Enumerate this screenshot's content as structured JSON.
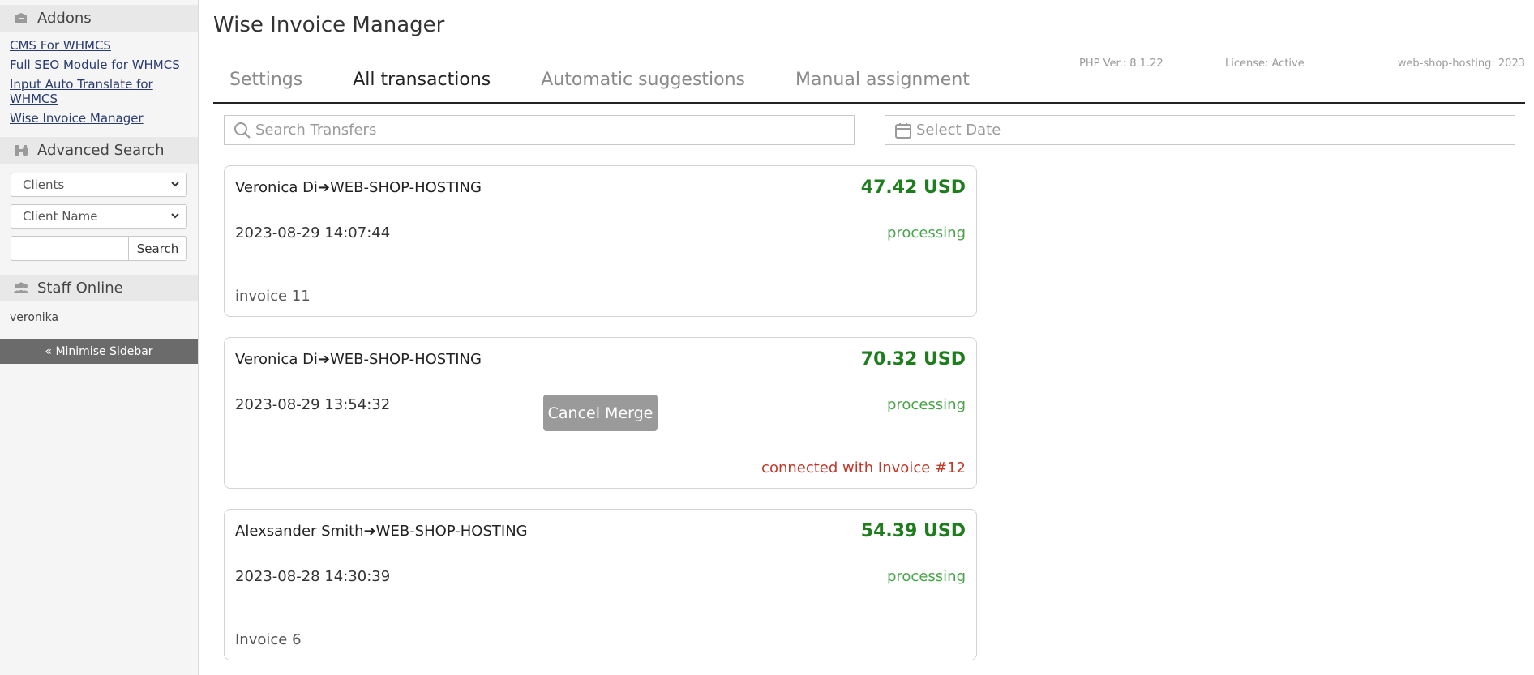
{
  "sidebar": {
    "addons_title": "Addons",
    "addon_links": [
      "CMS For WHMCS",
      "Full SEO Module for WHMCS",
      "Input Auto Translate for WHMCS",
      "Wise Invoice Manager"
    ],
    "advanced_search_title": "Advanced Search",
    "search_type": "Clients",
    "search_field": "Client Name",
    "search_button": "Search",
    "staff_online_title": "Staff Online",
    "staff_name": "veronika",
    "minimise_label": "« Minimise Sidebar"
  },
  "main": {
    "title": "Wise Invoice Manager",
    "tabs": [
      {
        "label": "Settings",
        "active": false
      },
      {
        "label": "All transactions",
        "active": true
      },
      {
        "label": "Automatic suggestions",
        "active": false
      },
      {
        "label": "Manual assignment",
        "active": false
      }
    ],
    "meta": {
      "php": "PHP Ver.: 8.1.22",
      "license": "License: Active",
      "site": "web-shop-hosting: 2023"
    },
    "search_placeholder": "Search Transfers",
    "date_placeholder": "Select Date"
  },
  "transactions": [
    {
      "payer": "Veronica Di➔WEB-SHOP-HOSTING",
      "amount": "47.42 USD",
      "date": "2023-08-29 14:07:44",
      "status": "processing",
      "note": "invoice 11"
    },
    {
      "payer": "Veronica Di➔WEB-SHOP-HOSTING",
      "amount": "70.32 USD",
      "date": "2023-08-29 13:54:32",
      "status": "processing",
      "cancel_label": "Cancel Merge",
      "connected": "connected with Invoice #12"
    },
    {
      "payer": "Alexsander Smith➔WEB-SHOP-HOSTING",
      "amount": "54.39 USD",
      "date": "2023-08-28 14:30:39",
      "status": "processing",
      "note": "Invoice 6"
    }
  ],
  "colors": {
    "amount": "#1e7e1e",
    "status": "#4aa34a",
    "connected": "#c0392b",
    "minimise_bg": "#6b6b6b"
  }
}
